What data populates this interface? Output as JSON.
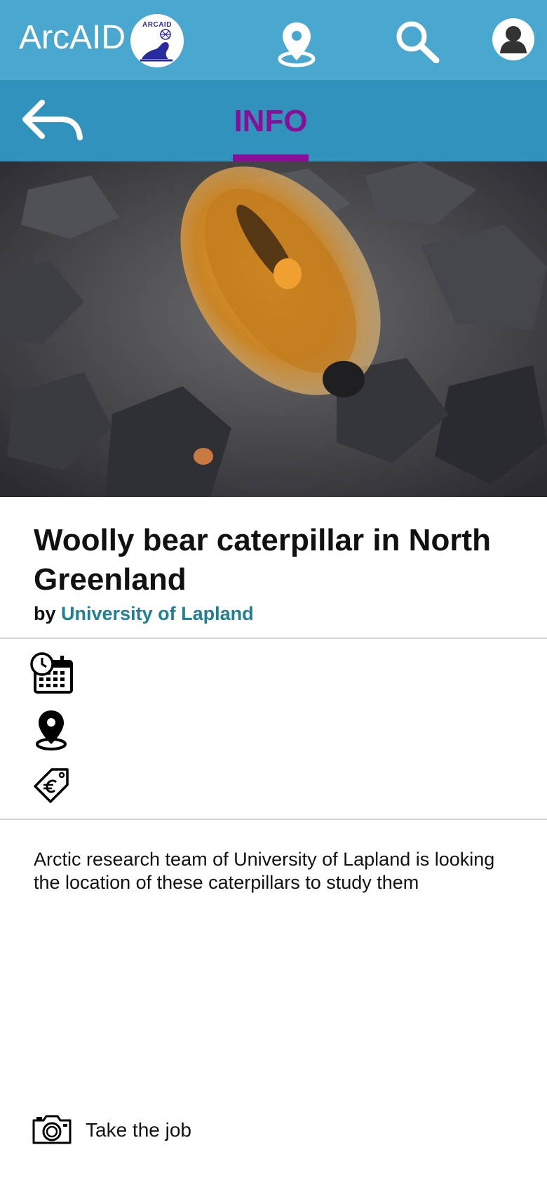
{
  "header": {
    "app_title": "ArcAID",
    "logo_text": "ARCAID",
    "icons": [
      "seal-logo",
      "map-pin-icon",
      "search-icon",
      "user-icon"
    ]
  },
  "subnav": {
    "back_icon": "back-arrow-icon",
    "active_tab": "INFO"
  },
  "colors": {
    "topbar": "#4aa8d0",
    "subbar": "#3192bb",
    "accent": "#8a0f98",
    "link": "#217f94"
  },
  "job": {
    "title": "Woolly bear caterpillar in North Greenland",
    "by_prefix": "by",
    "organization": "University of Lapland",
    "meta_icons": [
      "calendar-clock-icon",
      "location-pin-icon",
      "euro-tag-icon"
    ],
    "description": "Arctic research team of University of Lapland is looking the location of these caterpillars to study them"
  },
  "action": {
    "icon": "camera-icon",
    "label": "Take the job"
  }
}
